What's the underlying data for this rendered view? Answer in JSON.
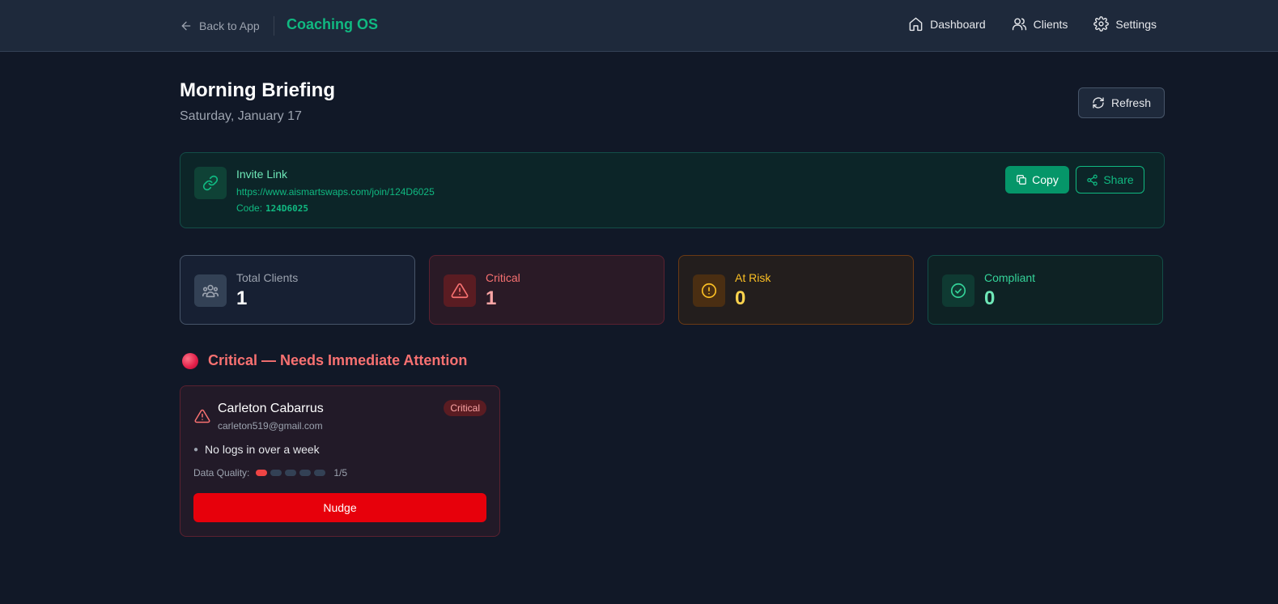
{
  "header": {
    "back_label": "Back to App",
    "brand": "Coaching OS",
    "nav": [
      {
        "label": "Dashboard",
        "icon": "home-icon"
      },
      {
        "label": "Clients",
        "icon": "users-icon"
      },
      {
        "label": "Settings",
        "icon": "gear-icon"
      }
    ]
  },
  "page": {
    "title": "Morning Briefing",
    "date": "Saturday, January 17",
    "refresh_label": "Refresh"
  },
  "invite": {
    "title": "Invite Link",
    "url": "https://www.aismartswaps.com/join/124D6025",
    "code_label": "Code:",
    "code": "124D6025",
    "copy_label": "Copy",
    "share_label": "Share"
  },
  "stats": {
    "total": {
      "label": "Total Clients",
      "value": "1"
    },
    "critical": {
      "label": "Critical",
      "value": "1"
    },
    "at_risk": {
      "label": "At Risk",
      "value": "0"
    },
    "compliant": {
      "label": "Compliant",
      "value": "0"
    }
  },
  "critical_section": {
    "title": "Critical — Needs Immediate Attention"
  },
  "client": {
    "name": "Carleton Cabarrus",
    "email": "carleton519@gmail.com",
    "badge": "Critical",
    "issues": [
      "No logs in over a week"
    ],
    "data_quality_label": "Data Quality:",
    "data_quality_value": 1,
    "data_quality_max": 5,
    "data_quality_text": "1/5",
    "nudge_label": "Nudge"
  },
  "colors": {
    "accent": "#10b981",
    "critical": "#ef4444",
    "at_risk": "#fbbf24",
    "background": "#111827"
  }
}
